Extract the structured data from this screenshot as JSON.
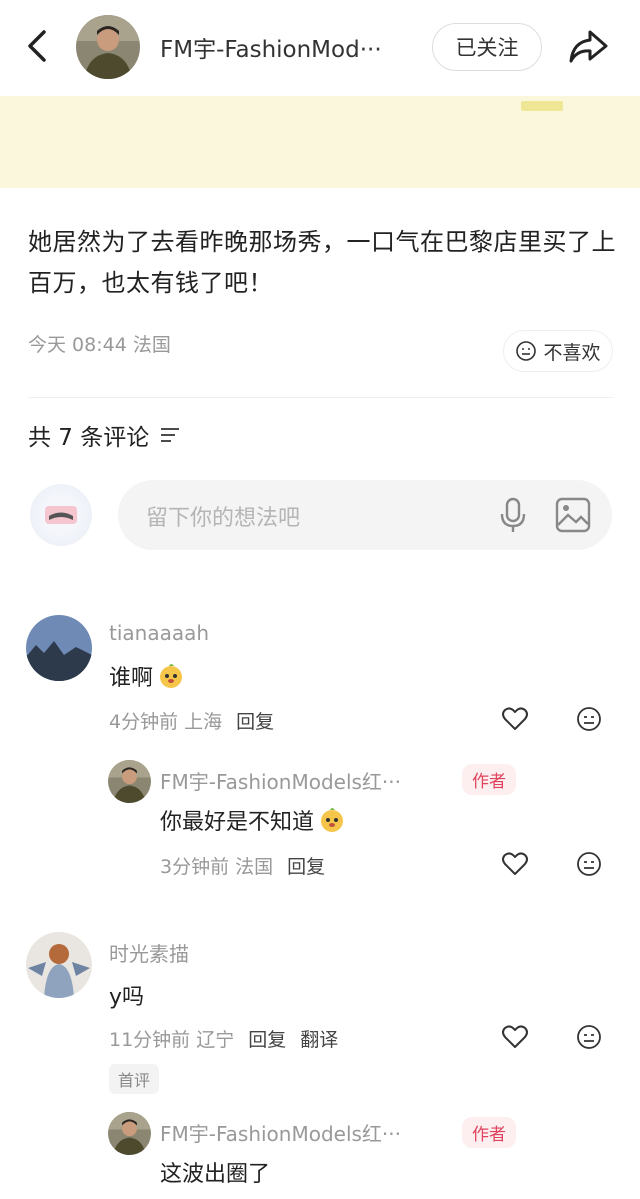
{
  "header": {
    "author_name": "FM宇-FashionMod···",
    "follow_label": "已关注"
  },
  "post": {
    "text": "她居然为了去看昨晚那场秀，一口气在巴黎店里买了上百万，也太有钱了吧！",
    "meta": "今天 08:44 法国",
    "dislike_label": "不喜欢"
  },
  "comments_section": {
    "count_label": "共 7 条评论",
    "input_placeholder": "留下你的想法吧"
  },
  "comments": [
    {
      "user": "tianaaaah",
      "text": "谁啊",
      "time_location": "4分钟前 上海",
      "reply_label": "回复",
      "replies": [
        {
          "user": "FM宇-FashionModels红···",
          "tag": "作者",
          "text": "你最好是不知道",
          "time_location": "3分钟前 法国",
          "reply_label": "回复"
        }
      ]
    },
    {
      "user": "时光素描",
      "text": "y吗",
      "time_location": "11分钟前 辽宁",
      "reply_label": "回复",
      "translate_label": "翻译",
      "badge": "首评",
      "replies": [
        {
          "user": "FM宇-FashionModels红···",
          "tag": "作者",
          "text": "这波出圈了"
        }
      ]
    }
  ],
  "colors": {
    "banner_bg": "#faf7dc",
    "author_tag": "#e0435d",
    "input_bg": "#f4f4f4"
  }
}
